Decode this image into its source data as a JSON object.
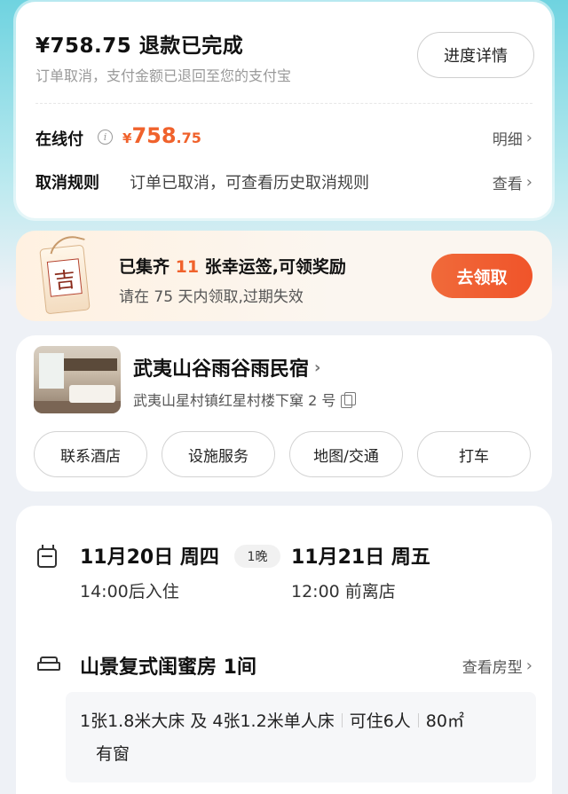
{
  "refund": {
    "title": "¥758.75 退款已完成",
    "subtitle": "订单取消，支付金额已退回至您的支付宝",
    "progress_button": "进度详情"
  },
  "payment": {
    "label": "在线付",
    "currency": "¥",
    "amount_int": "758",
    "amount_dec": ".75",
    "detail_link": "明细",
    "info_icon": "info-icon"
  },
  "cancel_rule": {
    "label": "取消规则",
    "desc": "订单已取消，可查看历史取消规则",
    "link": "查看"
  },
  "lucky": {
    "charm_char": "吉",
    "title_pre": "已集齐 ",
    "count": "11",
    "title_post": " 张幸运签,可领奖励",
    "subtitle": "请在 75 天内领取,过期失效",
    "claim_button": "去领取"
  },
  "hotel": {
    "name": "武夷山谷雨谷雨民宿",
    "address": "武夷山星村镇红星村楼下窠 2 号",
    "actions": [
      "联系酒店",
      "设施服务",
      "地图/交通",
      "打车"
    ]
  },
  "stay": {
    "checkin_date": "11月20日 周四",
    "checkin_time": "14:00后入住",
    "nights": "1晚",
    "checkout_date": "11月21日 周五",
    "checkout_time": "12:00 前离店"
  },
  "room": {
    "name": "山景复式闺蜜房  1间",
    "type_link": "查看房型",
    "beds": "1张1.8米大床 及 4张1.2米单人床",
    "capacity": "可住6人",
    "area": "80㎡",
    "window": "有窗"
  },
  "colors": {
    "accent": "#f0622c",
    "top_gradient": "#6fd3e0"
  }
}
